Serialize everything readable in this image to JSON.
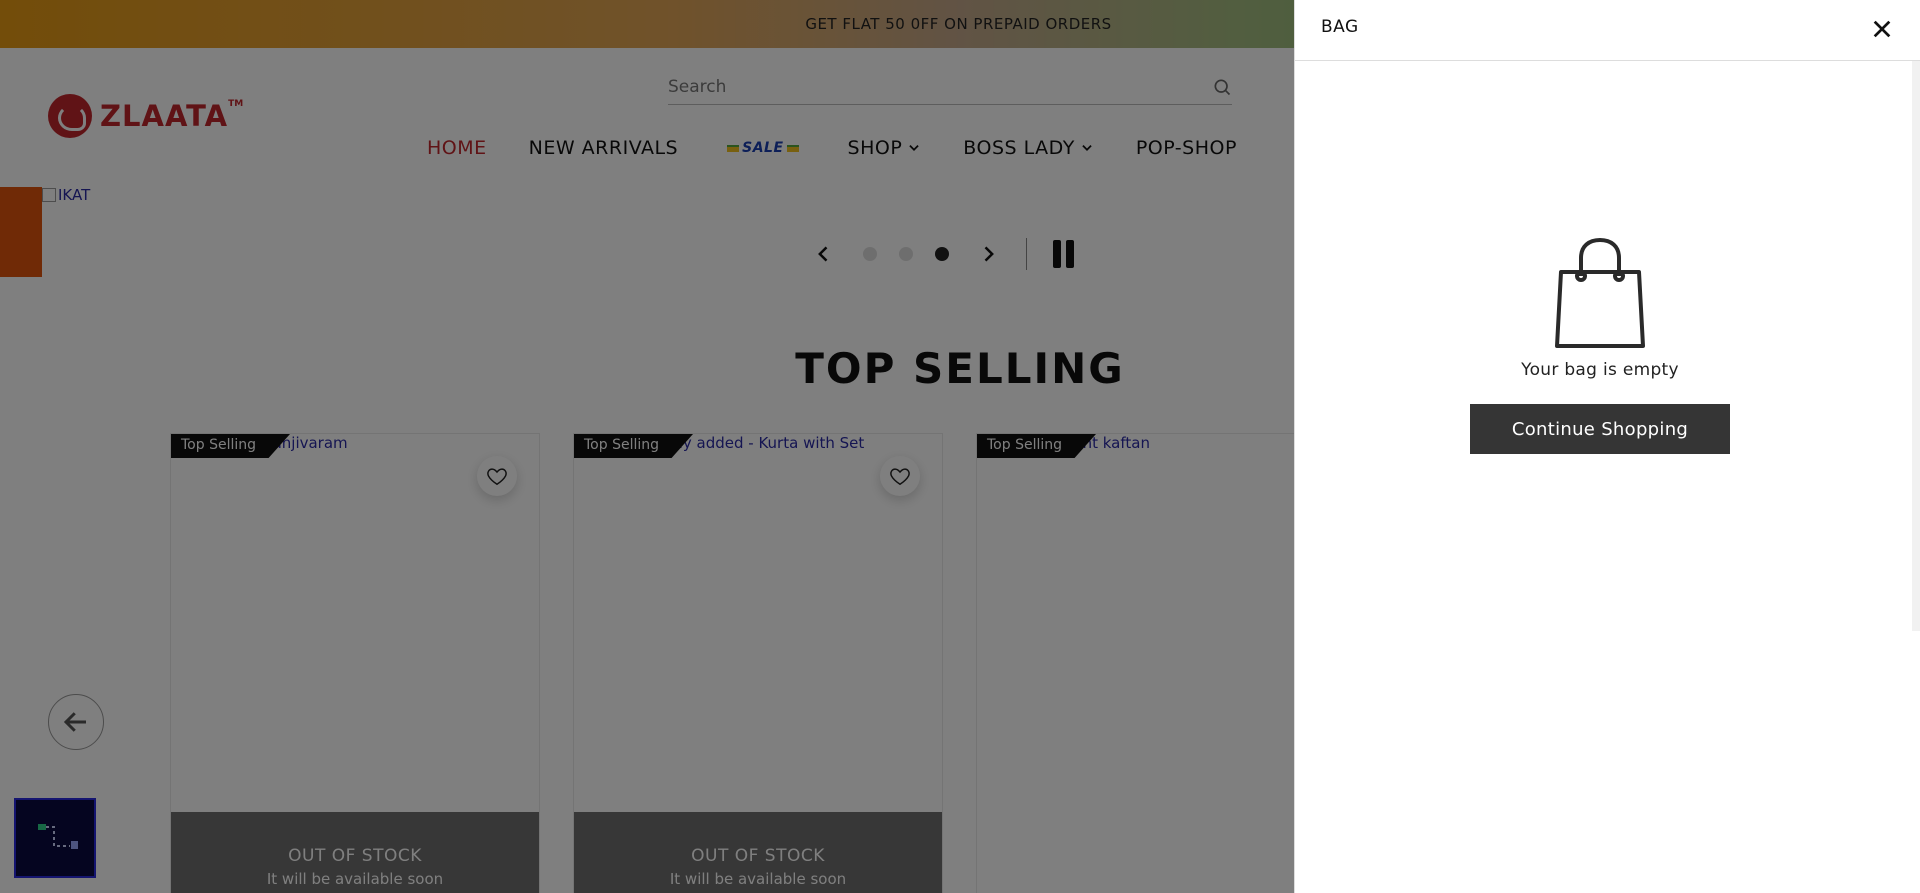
{
  "announcement": {
    "text": "GET FLAT 50 0FF ON PREPAID ORDERS"
  },
  "header": {
    "logo_text": "ZLAATA",
    "logo_tm": "TM",
    "search_placeholder": "Search",
    "nav": {
      "home": "HOME",
      "new_arrivals": "NEW ARRIVALS",
      "sale": "SALE",
      "shop": "SHOP",
      "boss_lady": "BOSS LADY",
      "pop_shop": "POP-SHOP"
    }
  },
  "hero": {
    "image_alt": "IKAT",
    "slide_count": 3,
    "active_slide": 3
  },
  "section": {
    "title": "TOP SELLING"
  },
  "products": [
    {
      "badge": "Top Selling",
      "title": "Kanjivaram",
      "oos_title": "OUT OF STOCK",
      "oos_sub": "It will be available soon"
    },
    {
      "badge": "Top Selling",
      "title": "Newly added - Kurta with Set",
      "oos_title": "OUT OF STOCK",
      "oos_sub": "It will be available soon"
    },
    {
      "badge": "Top Selling",
      "title": "Elegant kaftan",
      "oos_title": "",
      "oos_sub": ""
    }
  ],
  "bag": {
    "title": "BAG",
    "empty_text": "Your bag is empty",
    "continue_label": "Continue Shopping"
  },
  "colors": {
    "brand_red": "#c1272d",
    "overlay": "rgba(0,0,0,0.5)",
    "button_dark": "#353535"
  },
  "icons": [
    "search-icon",
    "chevron-down-icon",
    "chevron-left-icon",
    "chevron-right-icon",
    "pause-icon",
    "heart-icon",
    "arrow-left-icon",
    "close-icon",
    "shopping-bag-icon"
  ]
}
